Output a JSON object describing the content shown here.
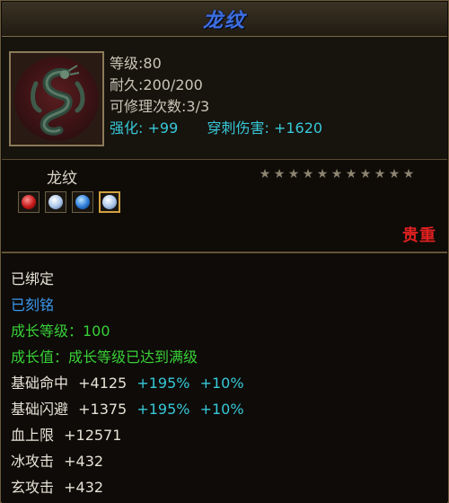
{
  "title": "龙纹",
  "top_stats": {
    "level": "等级:80",
    "durability": "耐久:200/200",
    "repairs": "可修理次数:3/3",
    "enhance_label": "强化:",
    "enhance_value": "+99",
    "pierce_label": "穿刺伤害:",
    "pierce_value": "+1620"
  },
  "item": {
    "name": "龙纹",
    "stars_total": 11,
    "rarity": "贵重",
    "gems": [
      "red",
      "white",
      "blue",
      "white"
    ],
    "selected_gem_index": 3
  },
  "attributes": {
    "bound": "已绑定",
    "engraved": "已刻铭",
    "growth_level": "成长等级：100",
    "growth_value": "成长值：成长等级已达到满级",
    "hit": {
      "label": "基础命中",
      "value": "+4125",
      "extra1": "+195%",
      "extra2": "+10%"
    },
    "dodge": {
      "label": "基础闪避",
      "value": "+1375",
      "extra1": "+195%",
      "extra2": "+10%"
    },
    "hp": {
      "label": "血上限",
      "value": "+12571"
    },
    "ice": {
      "label": "冰攻击",
      "value": "+432"
    },
    "mystic": {
      "label": "玄攻击",
      "value": "+432"
    }
  },
  "colors": {
    "title": "#3d6fe0",
    "cyan": "#37c8d8",
    "blue": "#3a9af0",
    "green": "#38d038",
    "rarity": "#e02020"
  }
}
